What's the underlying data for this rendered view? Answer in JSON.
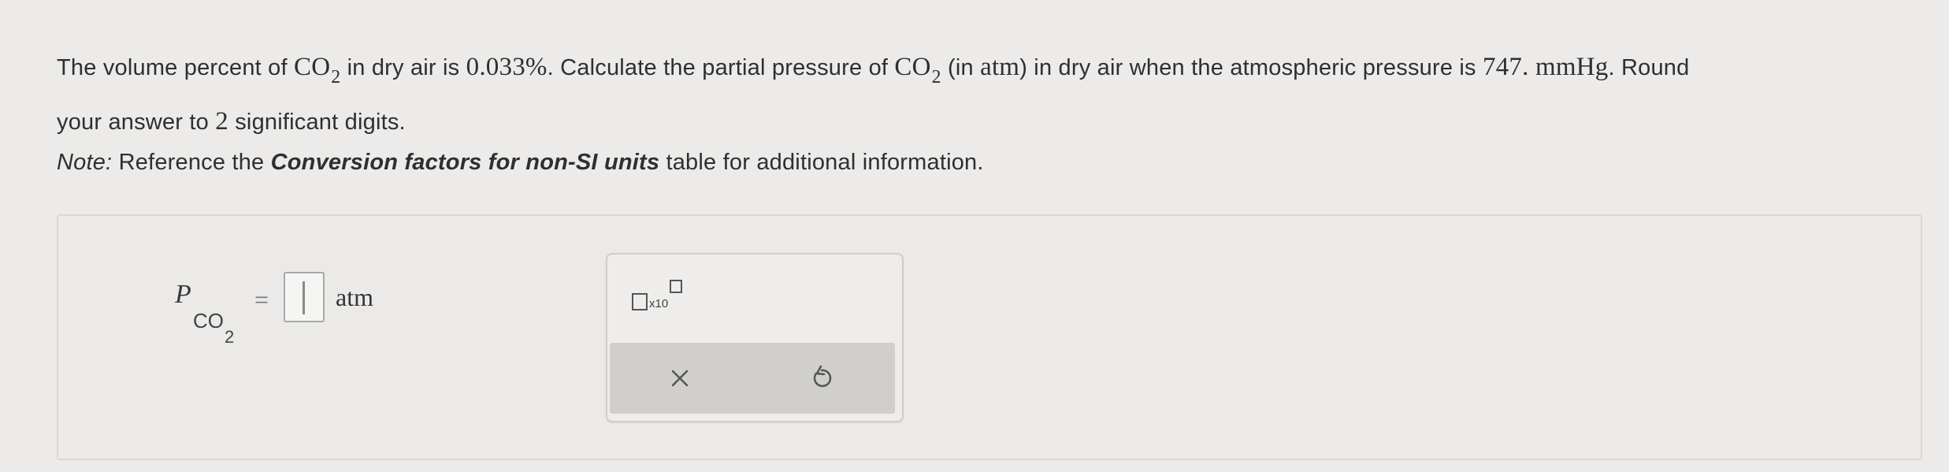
{
  "question": {
    "part1": "The volume percent of ",
    "co2": "CO",
    "co2_sub": "2",
    "part2": " in dry air is ",
    "percent": "0.033%",
    "part3": ". Calculate the partial pressure of ",
    "co2_b": "CO",
    "co2_b_sub": "2",
    "part4": " (in ",
    "atm_unit": "atm",
    "part5": ") in dry air when the atmospheric pressure is ",
    "pressure_value": "747. mmHg",
    "part6": ". Round",
    "line2_a": "your answer to ",
    "digits": "2",
    "line2_b": " significant digits."
  },
  "note": {
    "label": "Note:",
    "text_a": " Reference the ",
    "ref": "Conversion factors for non-SI units",
    "text_b": " table for additional information."
  },
  "answer": {
    "symbol": "P",
    "symbol_sub": "CO",
    "symbol_subsub": "2",
    "equals": "=",
    "value": "",
    "unit": "atm"
  },
  "toolbox": {
    "sci_label": "x10",
    "clear_icon": "close-icon",
    "undo_icon": "undo-icon",
    "clear_glyph": "×"
  },
  "colors": {
    "background": "#ecebea",
    "panel": "#ebeae8",
    "action_bar": "#d0cfcc",
    "text": "#2f2f2f"
  }
}
